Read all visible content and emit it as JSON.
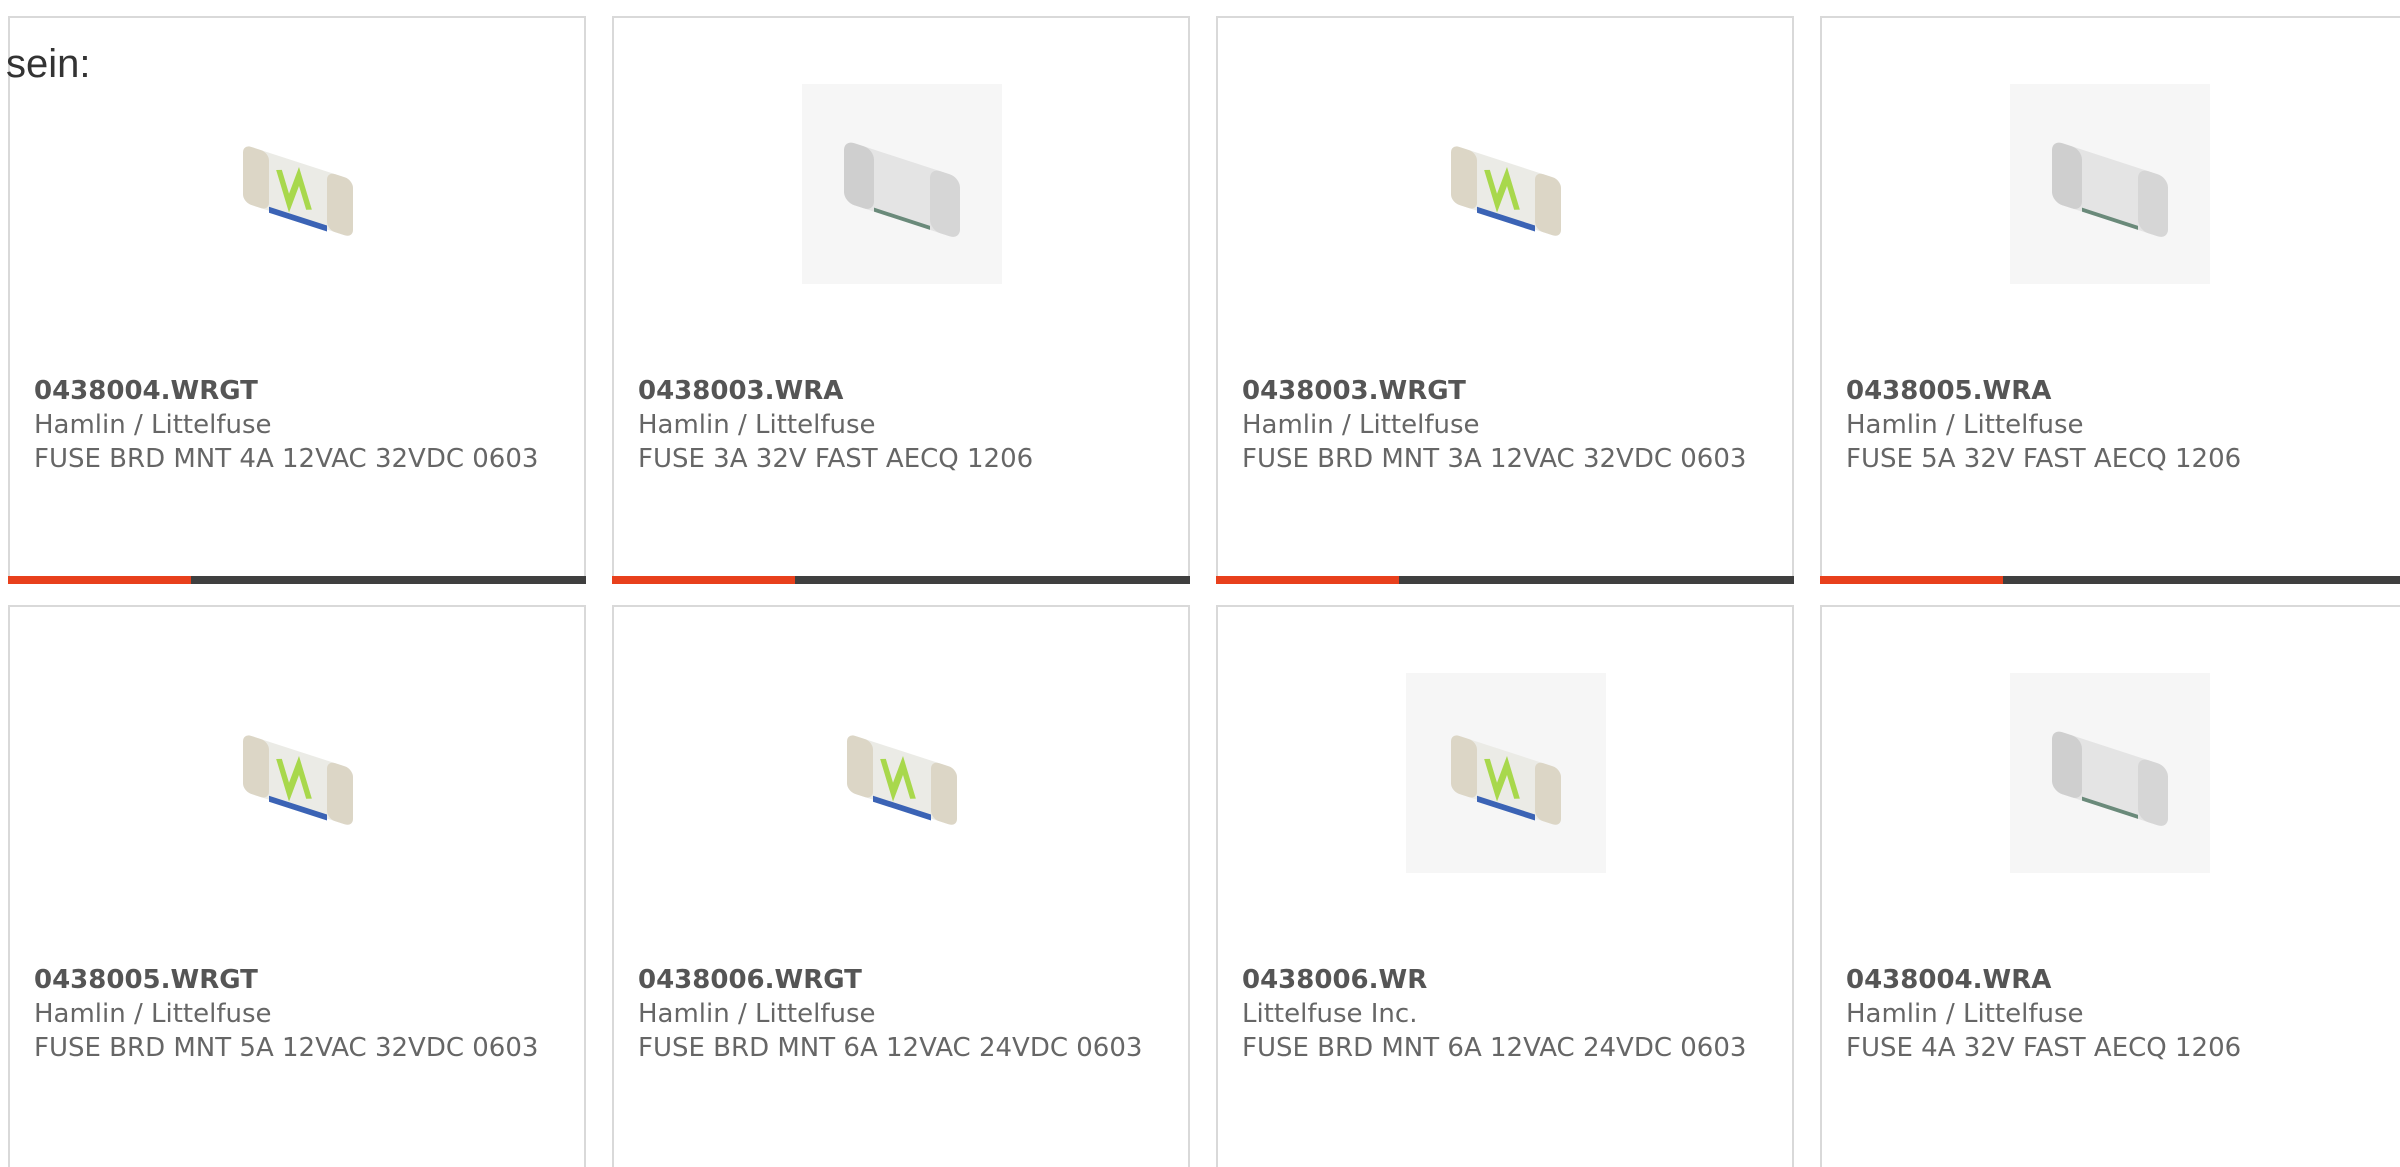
{
  "intro_text": "sein:",
  "colors": {
    "accent": "#e8401c",
    "bar": "#3f3f3f",
    "border": "#d9d9d9",
    "text": "#666666"
  },
  "products": [
    {
      "part_number": "0438004.WRGT",
      "manufacturer": "Hamlin / Littelfuse",
      "description": "FUSE BRD MNT 4A 12VAC 32VDC 0603",
      "image": "fuse-green-marking-icon"
    },
    {
      "part_number": "0438003.WRA",
      "manufacturer": "Hamlin / Littelfuse",
      "description": "FUSE 3A 32V FAST AECQ 1206",
      "image": "fuse-white-icon"
    },
    {
      "part_number": "0438003.WRGT",
      "manufacturer": "Hamlin / Littelfuse",
      "description": "FUSE BRD MNT 3A 12VAC 32VDC 0603",
      "image": "fuse-green-marking-icon"
    },
    {
      "part_number": "0438005.WRA",
      "manufacturer": "Hamlin / Littelfuse",
      "description": "FUSE 5A 32V FAST AECQ 1206",
      "image": "fuse-white-icon"
    },
    {
      "part_number": "0438005.WRGT",
      "manufacturer": "Hamlin / Littelfuse",
      "description": "FUSE BRD MNT 5A 12VAC 32VDC 0603",
      "image": "fuse-green-marking-icon"
    },
    {
      "part_number": "0438006.WRGT",
      "manufacturer": "Hamlin / Littelfuse",
      "description": "FUSE BRD MNT 6A 12VAC 24VDC 0603",
      "image": "fuse-green-marking-icon"
    },
    {
      "part_number": "0438006.WR",
      "manufacturer": "Littelfuse Inc.",
      "description": "FUSE BRD MNT 6A 12VAC 24VDC 0603",
      "image": "fuse-green-marking-icon"
    },
    {
      "part_number": "0438004.WRA",
      "manufacturer": "Hamlin / Littelfuse",
      "description": "FUSE 4A 32V FAST AECQ 1206",
      "image": "fuse-white-icon"
    }
  ]
}
